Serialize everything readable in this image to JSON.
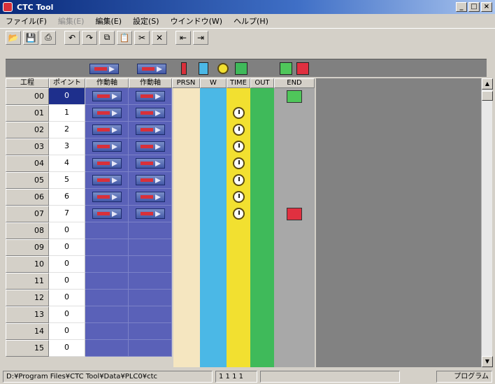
{
  "window": {
    "title": "CTC Tool",
    "min_label": "_",
    "max_label": "□",
    "close_label": "×"
  },
  "menu": [
    {
      "label": "ファイル(F)",
      "disabled": false
    },
    {
      "label": "編集(E)",
      "disabled": true
    },
    {
      "label": "編集(E)",
      "disabled": false
    },
    {
      "label": "設定(S)",
      "disabled": false
    },
    {
      "label": "ウインドウ(W)",
      "disabled": false
    },
    {
      "label": "ヘルプ(H)",
      "disabled": false
    }
  ],
  "toolbar": {
    "open_icon": "folder-open-icon",
    "save_icon": "save-icon",
    "print_icon": "print-icon",
    "undo_icon": "undo-icon",
    "redo_icon": "redo-icon",
    "copy_icon": "copy-icon",
    "paste_icon": "paste-icon",
    "cut_icon": "cut-icon",
    "delete_icon": "delete-icon",
    "prev_icon": "step-prev-icon",
    "next_icon": "step-next-icon"
  },
  "headers": {
    "step": "工程",
    "point": "ポイント",
    "act1": "作動軸",
    "act2": "作動軸",
    "prs": "PRSN",
    "w": "W",
    "time": "TIME",
    "out": "OUT",
    "end": "END"
  },
  "rows": [
    {
      "step": "00",
      "point": "0",
      "selected": true,
      "act": true,
      "timer": false,
      "end": "green"
    },
    {
      "step": "01",
      "point": "1",
      "selected": false,
      "act": true,
      "timer": true,
      "end": ""
    },
    {
      "step": "02",
      "point": "2",
      "selected": false,
      "act": true,
      "timer": true,
      "end": ""
    },
    {
      "step": "03",
      "point": "3",
      "selected": false,
      "act": true,
      "timer": true,
      "end": ""
    },
    {
      "step": "04",
      "point": "4",
      "selected": false,
      "act": true,
      "timer": true,
      "end": ""
    },
    {
      "step": "05",
      "point": "5",
      "selected": false,
      "act": true,
      "timer": true,
      "end": ""
    },
    {
      "step": "06",
      "point": "6",
      "selected": false,
      "act": true,
      "timer": true,
      "end": ""
    },
    {
      "step": "07",
      "point": "7",
      "selected": false,
      "act": true,
      "timer": true,
      "end": "red"
    },
    {
      "step": "08",
      "point": "0",
      "selected": false,
      "act": false,
      "timer": false,
      "end": ""
    },
    {
      "step": "09",
      "point": "0",
      "selected": false,
      "act": false,
      "timer": false,
      "end": ""
    },
    {
      "step": "10",
      "point": "0",
      "selected": false,
      "act": false,
      "timer": false,
      "end": ""
    },
    {
      "step": "11",
      "point": "0",
      "selected": false,
      "act": false,
      "timer": false,
      "end": ""
    },
    {
      "step": "12",
      "point": "0",
      "selected": false,
      "act": false,
      "timer": false,
      "end": ""
    },
    {
      "step": "13",
      "point": "0",
      "selected": false,
      "act": false,
      "timer": false,
      "end": ""
    },
    {
      "step": "14",
      "point": "0",
      "selected": false,
      "act": false,
      "timer": false,
      "end": ""
    },
    {
      "step": "15",
      "point": "0",
      "selected": false,
      "act": false,
      "timer": false,
      "end": ""
    }
  ],
  "status": {
    "path": "D:¥Program Files¥CTC Tool¥Data¥PLC0¥ctc",
    "code": "1 1 1 1",
    "mode": "プログラム"
  },
  "colors": {
    "actuator_bg": "#5a61b8",
    "prs_lane": "#f5e6c0",
    "w_lane": "#4bb8e6",
    "time_lane": "#f2e030",
    "out_lane": "#3fba5a",
    "end_lane": "#a8a8a8",
    "selected_cell": "#1e2f8c"
  }
}
